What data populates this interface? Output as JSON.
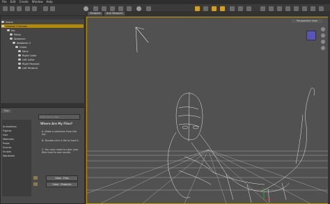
{
  "menu": [
    "File",
    "Edit",
    "Create",
    "Window",
    "Help"
  ],
  "scene": {
    "rows": [
      {
        "label": "Scene",
        "selected": false
      },
      {
        "label": "Genesis 2 Female",
        "selected": true
      },
      {
        "label": "hip",
        "selected": false
      },
      {
        "label": "Pelvis",
        "selected": false
      },
      {
        "label": "Abdomen",
        "selected": false
      },
      {
        "label": "Abdomen 2",
        "selected": false
      },
      {
        "label": "Chest",
        "selected": false
      },
      {
        "label": "Neck",
        "selected": false
      },
      {
        "label": "Right Collar",
        "selected": false
      },
      {
        "label": "Left Collar",
        "selected": false
      },
      {
        "label": "Right Pectoral",
        "selected": false
      },
      {
        "label": "Left Pectoral",
        "selected": false
      }
    ]
  },
  "library": {
    "tab": "Tips",
    "search_placeholder": "Enter text to filter...",
    "heading": "Where Are My Files?",
    "step_a": "A. Make a selection from the list.",
    "step_b": "B. Double-click a file to load it.",
    "step_c": "C. You may need to clear your filter text to see results.",
    "items": [
      "Animations",
      "Figures",
      "Hair",
      "Materials",
      "Props",
      "Scenes",
      "Scripts",
      "Wardrobe"
    ],
    "buttons": [
      "View - Files",
      "View - Products"
    ]
  },
  "viewport": {
    "tabs": [
      "Viewport",
      "Aux Viewport"
    ],
    "camera": "Perspective View",
    "accent": "#c49a00"
  }
}
